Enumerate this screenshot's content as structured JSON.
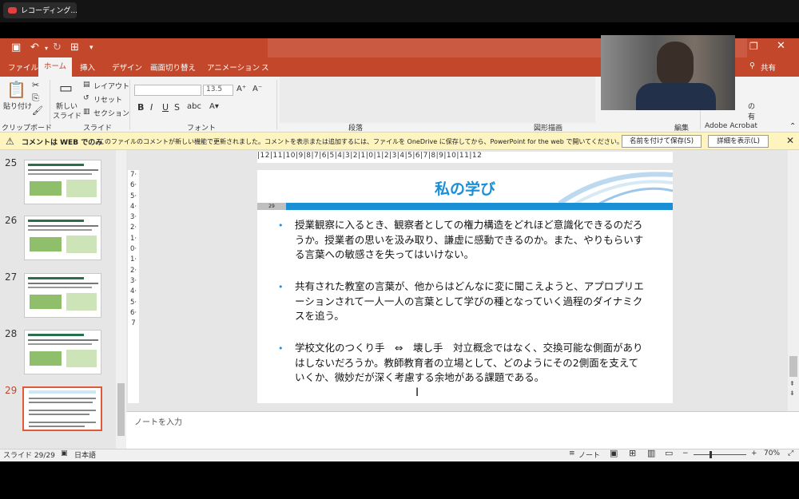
{
  "recording": {
    "title": "レコーディング..."
  },
  "window": {
    "restore": "❐",
    "close": "✕"
  },
  "tabs": [
    "ファイル",
    "ホーム",
    "挿入",
    "デザイン",
    "画面切り替え",
    "アニメーション",
    "ス"
  ],
  "share_label": "共有",
  "ribbon": {
    "paste": "貼り付け",
    "new_slide": "新しい",
    "new_slide2": "スライド",
    "layout": "レイアウト",
    "reset": "リセット",
    "section": "セクション",
    "font_size": "13.5",
    "groups": [
      "クリップボード",
      "スライド",
      "フォント",
      "段落",
      "図形描画",
      "編集",
      "Adobe Acrobat"
    ],
    "acrobat_side": "の",
    "acrobat_side2": "有"
  },
  "warning": {
    "bold": "コメントは WEB でのみ",
    "message": "このファイルのコメントが新しい機能で更新されました。コメントを表示または追加するには、ファイルを OneDrive に保存してから、PowerPoint for the web で開いてください。",
    "save_button": "名前を付けて保存(S)",
    "details_button": "詳細を表示(L)"
  },
  "thumbnails": {
    "numbers": [
      "25",
      "26",
      "27",
      "28",
      "29"
    ]
  },
  "ruler": "|12|11|10|9|8|7|6|5|4|3|2|1|0|1|2|3|4|5|6|7|8|9|10|11|12",
  "vruler": "7·6·5·4·3·2·1·0·1·2·3·4·5·6·7",
  "slide": {
    "title": "私の学び",
    "number": "29",
    "bullets": [
      "授業観察に入るとき、観察者としての権力構造をどれほど意識化できるのだろうか。授業者の思いを汲み取り、謙虚に感動できるのか。また、やりもらいする言葉への敏感さを失ってはいけない。",
      "共有された教室の言葉が、他からはどんなに変に聞こえようと、アプロプリエーションされて一人一人の言葉として学びの種となっていく過程のダイナミクスを追う。",
      "学校文化のつくり手　⇔　壊し手　対立概念ではなく、交換可能な側面がありはしないだろうか。教師教育者の立場として、どのようにその2側面を支えていくか、微妙だが深く考慮する余地がある課題である。"
    ]
  },
  "notes_placeholder": "ノートを入力",
  "status": {
    "slide": "スライド 29/29",
    "language": "日本語",
    "notes": "ノート",
    "zoom": "70%"
  }
}
